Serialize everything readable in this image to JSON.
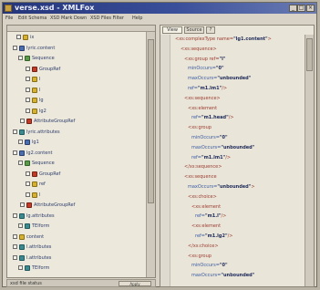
{
  "window": {
    "title": "verse.xsd - XMLFox"
  },
  "menu": [
    "File",
    "Edit Schema",
    "XSD Mark Down",
    "XSD Files Filter",
    "Help"
  ],
  "tabs": [
    "View",
    "Source",
    "?"
  ],
  "tree": [
    {
      "label": "ix",
      "icon": "folder",
      "color": "yellow"
    },
    {
      "label": "lyric.content",
      "icon": "complex-type",
      "color": "blue"
    },
    {
      "label": "Sequence",
      "icon": "sequence",
      "color": "green"
    },
    {
      "label": "GroupRef",
      "icon": "group-ref",
      "color": "red"
    },
    {
      "label": "l",
      "icon": "element",
      "color": "yellow"
    },
    {
      "label": "l",
      "icon": "element",
      "color": "yellow"
    },
    {
      "label": "lg",
      "icon": "element",
      "color": "yellow"
    },
    {
      "label": "lg2",
      "icon": "element",
      "color": "yellow"
    },
    {
      "label": "AttributeGroupRef",
      "icon": "attribute-group-ref",
      "color": "red"
    },
    {
      "label": "lyric.attributes",
      "icon": "attribute-group",
      "color": "teal"
    },
    {
      "label": "lg1",
      "icon": "element",
      "color": "blue"
    },
    {
      "label": "lg2.content",
      "icon": "complex-type",
      "color": "blue"
    },
    {
      "label": "Sequence",
      "icon": "sequence",
      "color": "green"
    },
    {
      "label": "GroupRef",
      "icon": "group-ref",
      "color": "red"
    },
    {
      "label": "ref",
      "icon": "element",
      "color": "yellow"
    },
    {
      "label": "l",
      "icon": "element",
      "color": "yellow"
    },
    {
      "label": "AttributeGroupRef",
      "icon": "attribute-group-ref",
      "color": "red"
    },
    {
      "label": "lg.attributes",
      "icon": "attribute-group",
      "color": "teal"
    },
    {
      "label": "TEIform",
      "icon": "attribute",
      "color": "teal"
    },
    {
      "label": "content",
      "icon": "element",
      "color": "yellow"
    },
    {
      "label": "l.attributes",
      "icon": "attribute-group",
      "color": "teal"
    },
    {
      "label": "l.attributes",
      "icon": "attribute-group",
      "color": "teal"
    },
    {
      "label": "TEIform",
      "icon": "attribute",
      "color": "teal"
    }
  ],
  "status": {
    "text": "xsd file status",
    "button": "Apply"
  },
  "xml": [
    {
      "tag": "<xs:complexType name=",
      "val": "\"lg1.content\"",
      "end": ">"
    },
    {
      "tag": "<xs:sequence>",
      "val": "",
      "end": ""
    },
    {
      "tag": "<xs:group ref=",
      "val": "\"l\"",
      "end": ""
    },
    {
      "tag": "minOccurs=",
      "val": "\"0\"",
      "end": ""
    },
    {
      "tag": "maxOccurs=",
      "val": "\"unbounded\"",
      "end": ""
    },
    {
      "tag": "ref=",
      "val": "\"m1.lm1\"",
      "end": "/>"
    },
    {
      "tag": "<xs:sequence>",
      "val": "",
      "end": ""
    },
    {
      "tag": "<xs:element",
      "val": "",
      "end": ""
    },
    {
      "tag": "ref=",
      "val": "\"m1.head\"",
      "end": "/>"
    },
    {
      "tag": "<xs:group",
      "val": "",
      "end": ""
    },
    {
      "tag": "minOccurs=",
      "val": "\"0\"",
      "end": ""
    },
    {
      "tag": "maxOccurs=",
      "val": "\"unbounded\"",
      "end": ""
    },
    {
      "tag": "ref=",
      "val": "\"m1.lm1\"",
      "end": "/>"
    },
    {
      "tag": "</xs:sequence>",
      "val": "",
      "end": ""
    },
    {
      "tag": "<xs:sequence",
      "val": "",
      "end": ""
    },
    {
      "tag": "maxOccurs=",
      "val": "\"unbounded\"",
      "end": ">"
    },
    {
      "tag": "<xs:choice>",
      "val": "",
      "end": ""
    },
    {
      "tag": "<xs:element",
      "val": "",
      "end": ""
    },
    {
      "tag": "ref=",
      "val": "\"m1.l\"",
      "end": "/>"
    },
    {
      "tag": "<xs:element",
      "val": "",
      "end": ""
    },
    {
      "tag": "ref=",
      "val": "\"m1.lg2\"",
      "end": "/>"
    },
    {
      "tag": "</xs:choice>",
      "val": "",
      "end": ""
    },
    {
      "tag": "<xs:group",
      "val": "",
      "end": ""
    },
    {
      "tag": "minOccurs=",
      "val": "\"0\"",
      "end": ""
    },
    {
      "tag": "maxOccurs=",
      "val": "\"unbounded\"",
      "end": ""
    }
  ]
}
